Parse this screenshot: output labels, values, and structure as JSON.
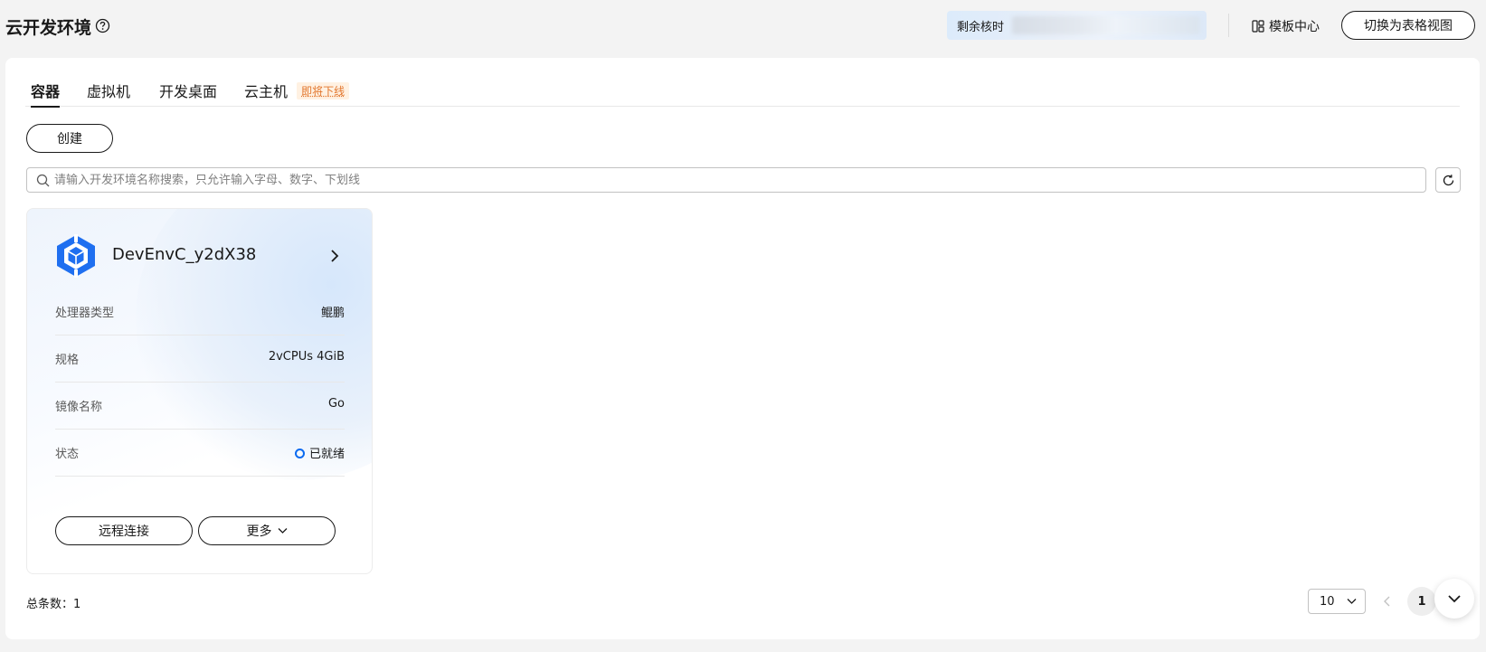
{
  "header": {
    "title": "云开发环境",
    "quota_label": "剩余核时",
    "template_center": "模板中心",
    "switch_view": "切换为表格视图"
  },
  "tabs": [
    {
      "label": "容器",
      "active": true
    },
    {
      "label": "虚拟机",
      "active": false
    },
    {
      "label": "开发桌面",
      "active": false
    },
    {
      "label": "云主机",
      "active": false,
      "badge": "即将下线"
    }
  ],
  "toolbar": {
    "create_label": "创建",
    "search_placeholder": "请输入开发环境名称搜索，只允许输入字母、数字、下划线"
  },
  "card": {
    "name": "DevEnvC_y2dX38",
    "rows": [
      {
        "label": "处理器类型",
        "value": "鲲鹏"
      },
      {
        "label": "规格",
        "value": "2vCPUs 4GiB"
      },
      {
        "label": "镜像名称",
        "value": "Go"
      },
      {
        "label": "状态",
        "value": "已就绪"
      }
    ],
    "remote_connect": "远程连接",
    "more": "更多"
  },
  "pagination": {
    "total_label": "总条数：1",
    "page_size": "10",
    "current_page": "1"
  },
  "colors": {
    "accent": "#0a6af0",
    "badge_bg": "#fff1e2",
    "badge_text": "#e2762d"
  }
}
